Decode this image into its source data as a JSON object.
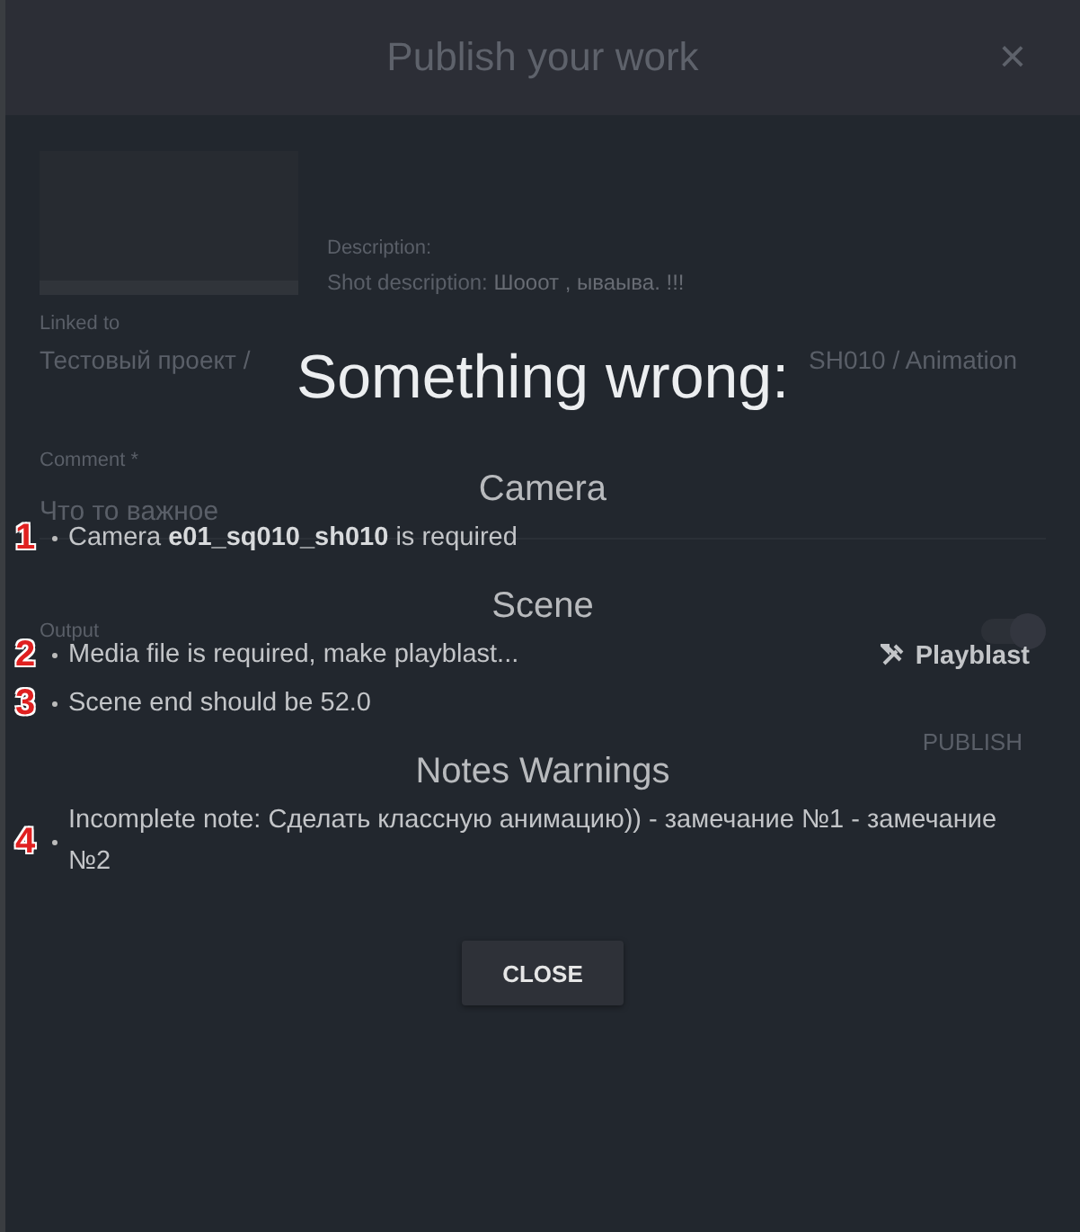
{
  "background_dialog": {
    "title": "Publish your work",
    "close": "×",
    "description_label": "Description:",
    "shot_description_label": "Shot description:",
    "shot_description": "Шооот , ываыва. !!!",
    "linked_label": "Linked to",
    "linked_path_start": "Тестовый проект /",
    "linked_path_end": "SH010 / Animation",
    "comment_label": "Comment *",
    "comment_value": "Что то важное",
    "output_label": "Output",
    "output_toggle": {
      "on": true
    },
    "publish_button": "PUBLISH"
  },
  "error_dialog": {
    "title": "Something wrong:",
    "sections": [
      {
        "heading": "Camera",
        "items": [
          {
            "marker": "1",
            "text": "Camera **e01_sq010_sh010** is required"
          }
        ]
      },
      {
        "heading": "Scene",
        "items": [
          {
            "marker": "2",
            "text": "Media file is required, make playblast...",
            "action": "Playblast"
          },
          {
            "marker": "3",
            "text": "Scene end should be 52.0"
          }
        ]
      },
      {
        "heading": "Notes Warnings",
        "items": [
          {
            "marker": "4",
            "text": "Incomplete note: Сделать классную анимацию)) - замечание №1 - замечание №2"
          }
        ]
      }
    ],
    "close_button": "CLOSE"
  }
}
